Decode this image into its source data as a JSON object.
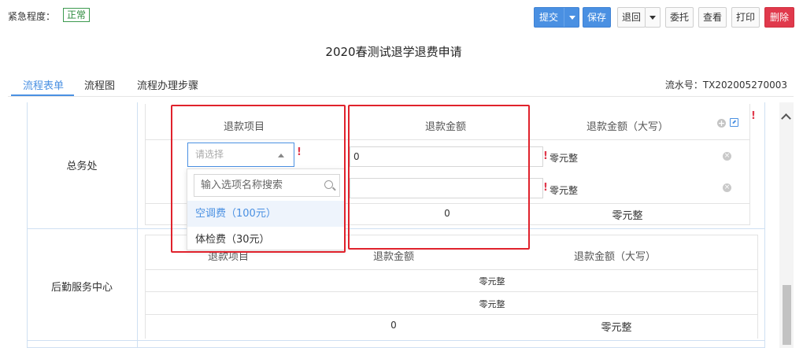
{
  "header": {
    "urgency_label": "紧急程度：",
    "urgency_value": "正常",
    "buttons": {
      "submit": "提交",
      "save": "保存",
      "return": "退回",
      "delegate": "委托",
      "view": "查看",
      "print": "打印",
      "delete": "删除"
    }
  },
  "page_title": "2020春测试退学退费申请",
  "tabs": [
    "流程表单",
    "流程图",
    "流程办理步骤"
  ],
  "serial_number": "流水号：TX202005270003",
  "section1": {
    "department": "总务处",
    "columns": [
      "退款项目",
      "退款金额",
      "退款金额（大写）"
    ],
    "rows": [
      {
        "item_placeholder": "请选择",
        "amount": "0",
        "amount_words": "零元整"
      },
      {
        "item_placeholder": "",
        "amount": "",
        "amount_words": "零元整"
      }
    ],
    "total_amount": "0",
    "total_words": "零元整",
    "dropdown": {
      "search_placeholder": "输入选项名称搜索",
      "options": [
        "空调费（100元）",
        "体检费（30元）"
      ]
    }
  },
  "section2": {
    "department": "后勤服务中心",
    "columns": [
      "退款项目",
      "退款金额",
      "退款金额（大写）"
    ],
    "rows": [
      {
        "amount_words": "零元整"
      },
      {
        "amount_words": "零元整"
      }
    ],
    "total_amount": "0",
    "total_words": "零元整"
  },
  "colors": {
    "accent": "#4a90e2",
    "danger": "#e0394c",
    "highlight_box": "#e0222c",
    "badge_green": "#2e8b3e"
  }
}
